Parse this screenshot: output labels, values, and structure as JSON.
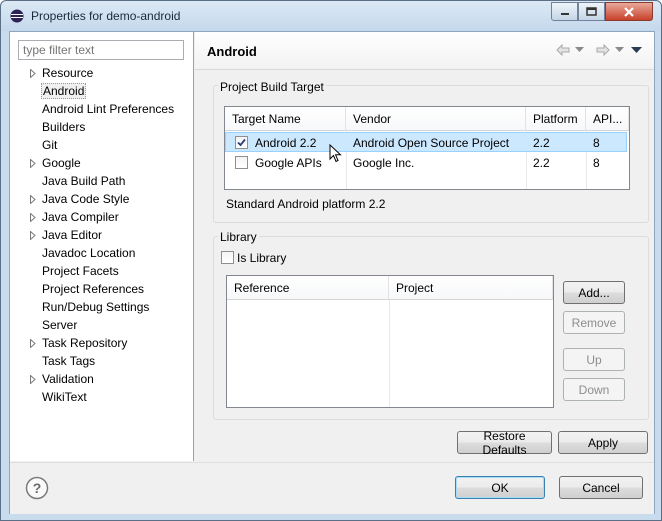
{
  "window": {
    "title": "Properties for demo-android"
  },
  "sidebar": {
    "filter_placeholder": "type filter text",
    "items": [
      {
        "label": "Resource",
        "expandable": true
      },
      {
        "label": "Android",
        "expandable": false,
        "selected": true
      },
      {
        "label": "Android Lint Preferences",
        "expandable": false
      },
      {
        "label": "Builders",
        "expandable": false
      },
      {
        "label": "Git",
        "expandable": false
      },
      {
        "label": "Google",
        "expandable": true
      },
      {
        "label": "Java Build Path",
        "expandable": false
      },
      {
        "label": "Java Code Style",
        "expandable": true
      },
      {
        "label": "Java Compiler",
        "expandable": true
      },
      {
        "label": "Java Editor",
        "expandable": true
      },
      {
        "label": "Javadoc Location",
        "expandable": false
      },
      {
        "label": "Project Facets",
        "expandable": false
      },
      {
        "label": "Project References",
        "expandable": false
      },
      {
        "label": "Run/Debug Settings",
        "expandable": false
      },
      {
        "label": "Server",
        "expandable": false
      },
      {
        "label": "Task Repository",
        "expandable": true
      },
      {
        "label": "Task Tags",
        "expandable": false
      },
      {
        "label": "Validation",
        "expandable": true
      },
      {
        "label": "WikiText",
        "expandable": false
      }
    ]
  },
  "page": {
    "title": "Android"
  },
  "build_target": {
    "group_label": "Project Build Target",
    "columns": [
      "Target Name",
      "Vendor",
      "Platform",
      "API..."
    ],
    "rows": [
      {
        "name": "Android 2.2",
        "vendor": "Android Open Source Project",
        "platform": "2.2",
        "api": "8",
        "checked": true
      },
      {
        "name": "Google APIs",
        "vendor": "Google Inc.",
        "platform": "2.2",
        "api": "8",
        "checked": false
      }
    ],
    "description": "Standard Android platform 2.2"
  },
  "library": {
    "group_label": "Library",
    "is_library_label": "Is Library",
    "is_library_checked": false,
    "columns": [
      "Reference",
      "Project"
    ],
    "buttons": {
      "add": "Add...",
      "remove": "Remove",
      "up": "Up",
      "down": "Down"
    }
  },
  "page_buttons": {
    "restore_defaults": "Restore Defaults",
    "apply": "Apply"
  },
  "footer": {
    "ok": "OK",
    "cancel": "Cancel"
  },
  "colors": {
    "selection_row": "#cce8ff",
    "title_bar": "#c9dcee",
    "close_button": "#c7412a"
  }
}
